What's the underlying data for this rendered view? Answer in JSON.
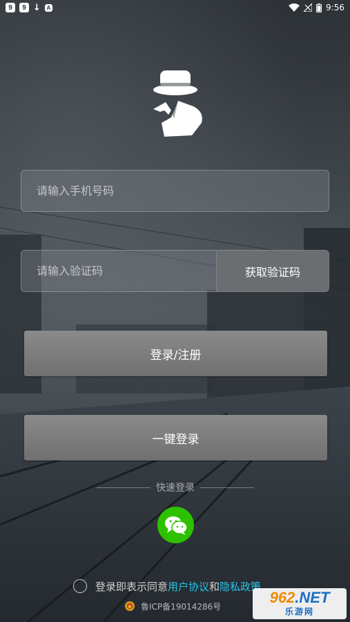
{
  "status_bar": {
    "left_badges": [
      "9",
      "9",
      "↓",
      "A"
    ],
    "time": "9:56"
  },
  "phone_input": {
    "placeholder": "请输入手机号码",
    "value": ""
  },
  "code_input": {
    "placeholder": "请输入验证码",
    "value": ""
  },
  "get_code_label": "获取验证码",
  "login_register_label": "登录/注册",
  "one_click_login_label": "一键登录",
  "quick_login_label": "快速登录",
  "agreement": {
    "prefix": "登录即表示同意",
    "user_agreement": "用户协议",
    "and": "和",
    "privacy_policy": "隐私政策"
  },
  "icp": "鲁ICP备19014286号",
  "watermark": {
    "num": "962",
    "net": ".NET",
    "bottom": "乐游网"
  },
  "colors": {
    "link": "#27c4e8",
    "wechat": "#2dc100",
    "button": "#7c7c7c"
  },
  "icons": [
    "spy-logo-icon",
    "wechat-icon",
    "wifi-icon",
    "signal-icon",
    "battery-icon",
    "police-badge-icon"
  ]
}
